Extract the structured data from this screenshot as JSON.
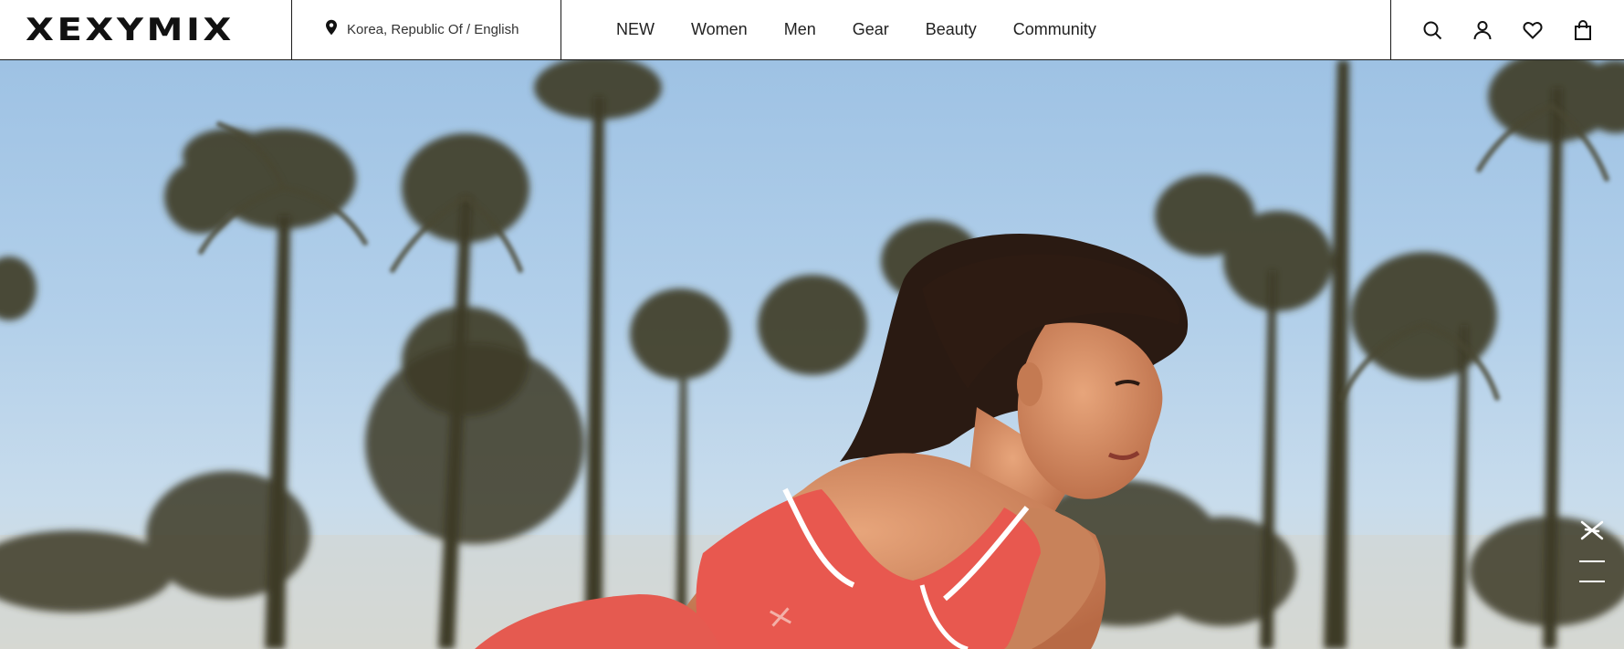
{
  "brand": {
    "logo_text": "XEXYMIX"
  },
  "region": {
    "label": "Korea, Republic Of / English",
    "icon": "map-pin-icon"
  },
  "nav": {
    "items": [
      {
        "label": "NEW"
      },
      {
        "label": "Women"
      },
      {
        "label": "Men"
      },
      {
        "label": "Gear"
      },
      {
        "label": "Beauty"
      },
      {
        "label": "Community"
      }
    ]
  },
  "utilities": {
    "icons": [
      "search-icon",
      "account-icon",
      "wishlist-heart-icon",
      "shopping-bag-icon"
    ]
  },
  "hero": {
    "image": "woman-in-coral-sports-bra-with-palm-trees",
    "colors": {
      "sky": "#a9c9e8",
      "outfit": "#e8584f",
      "palms": "#3b3a2a"
    }
  },
  "side_tools": {
    "icons": [
      "brand-x-icon",
      "menu-icon"
    ]
  }
}
